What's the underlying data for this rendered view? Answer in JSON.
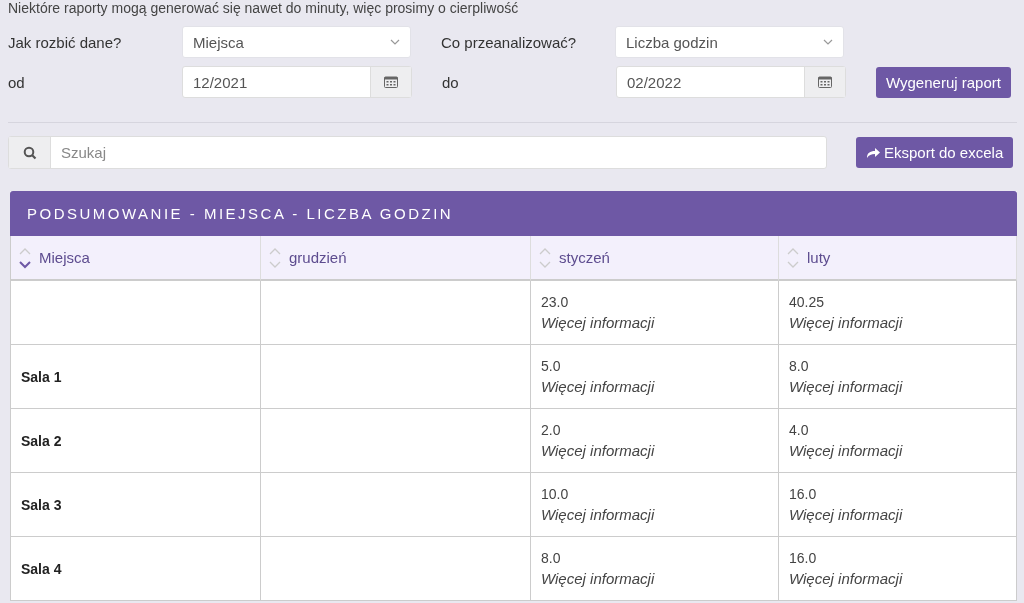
{
  "notice": "Niektóre raporty mogą generować się nawet do minuty, więc prosimy o cierpliwość",
  "filters": {
    "split_label": "Jak rozbić dane?",
    "split_value": "Miejsca",
    "analyze_label": "Co przeanalizować?",
    "analyze_value": "Liczba godzin",
    "from_label": "od",
    "from_value": "12/2021",
    "to_label": "do",
    "to_value": "02/2022",
    "generate_button": "Wygeneruj raport"
  },
  "search": {
    "placeholder": "Szukaj"
  },
  "export_button": "Eksport do excela",
  "table": {
    "title": "PODSUMOWANIE - MIEJSCA - LICZBA GODZIN",
    "columns": [
      {
        "label": "Miejsca",
        "sorted_descending": true
      },
      {
        "label": "grudzień",
        "sorted_descending": false
      },
      {
        "label": "styczeń",
        "sorted_descending": false
      },
      {
        "label": "luty",
        "sorted_descending": false
      }
    ],
    "rows": [
      {
        "cells": [
          "",
          "",
          {
            "value": "23.0",
            "link": "Więcej informacji"
          },
          {
            "value": "40.25",
            "link": "Więcej informacji"
          }
        ]
      },
      {
        "cells": [
          "Sala 1",
          "",
          {
            "value": "5.0",
            "link": "Więcej informacji"
          },
          {
            "value": "8.0",
            "link": "Więcej informacji"
          }
        ]
      },
      {
        "cells": [
          "Sala 2",
          "",
          {
            "value": "2.0",
            "link": "Więcej informacji"
          },
          {
            "value": "4.0",
            "link": "Więcej informacji"
          }
        ]
      },
      {
        "cells": [
          "Sala 3",
          "",
          {
            "value": "10.0",
            "link": "Więcej informacji"
          },
          {
            "value": "16.0",
            "link": "Więcej informacji"
          }
        ]
      },
      {
        "cells": [
          "Sala 4",
          "",
          {
            "value": "8.0",
            "link": "Więcej informacji"
          },
          {
            "value": "16.0",
            "link": "Więcej informacji"
          }
        ]
      }
    ]
  }
}
